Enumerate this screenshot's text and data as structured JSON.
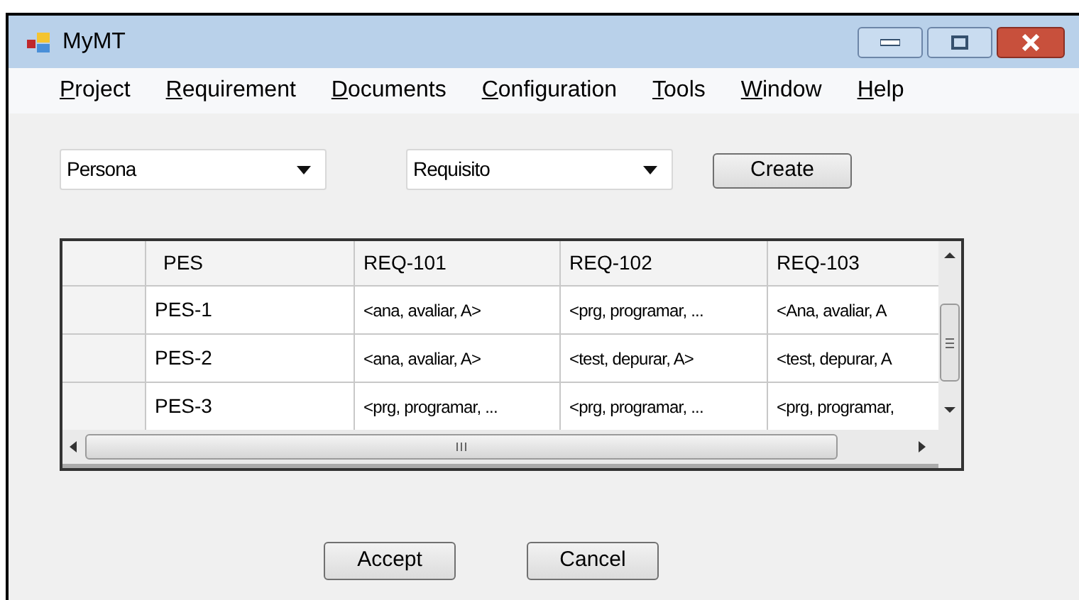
{
  "window": {
    "title": "MyMT"
  },
  "menu": [
    "Project",
    "Requirement",
    "Documents",
    "Configuration",
    "Tools",
    "Window",
    "Help"
  ],
  "dropdowns": [
    {
      "value": "Persona"
    },
    {
      "value": "Requisito"
    }
  ],
  "create_button": "Create",
  "table": {
    "columns": [
      "PES",
      "REQ-101",
      "REQ-102",
      "REQ-103"
    ],
    "rows": [
      [
        "PES-1",
        "<ana, avaliar, A>",
        "<prg, programar, ...",
        "<Ana, avaliar, A"
      ],
      [
        "PES-2",
        "<ana, avaliar, A>",
        "<test, depurar, A>",
        "<test, depurar, A"
      ],
      [
        "PES-3",
        "<prg, programar, ...",
        "<prg, programar, ...",
        "<prg, programar,"
      ]
    ]
  },
  "buttons": [
    "Accept",
    "Cancel"
  ]
}
